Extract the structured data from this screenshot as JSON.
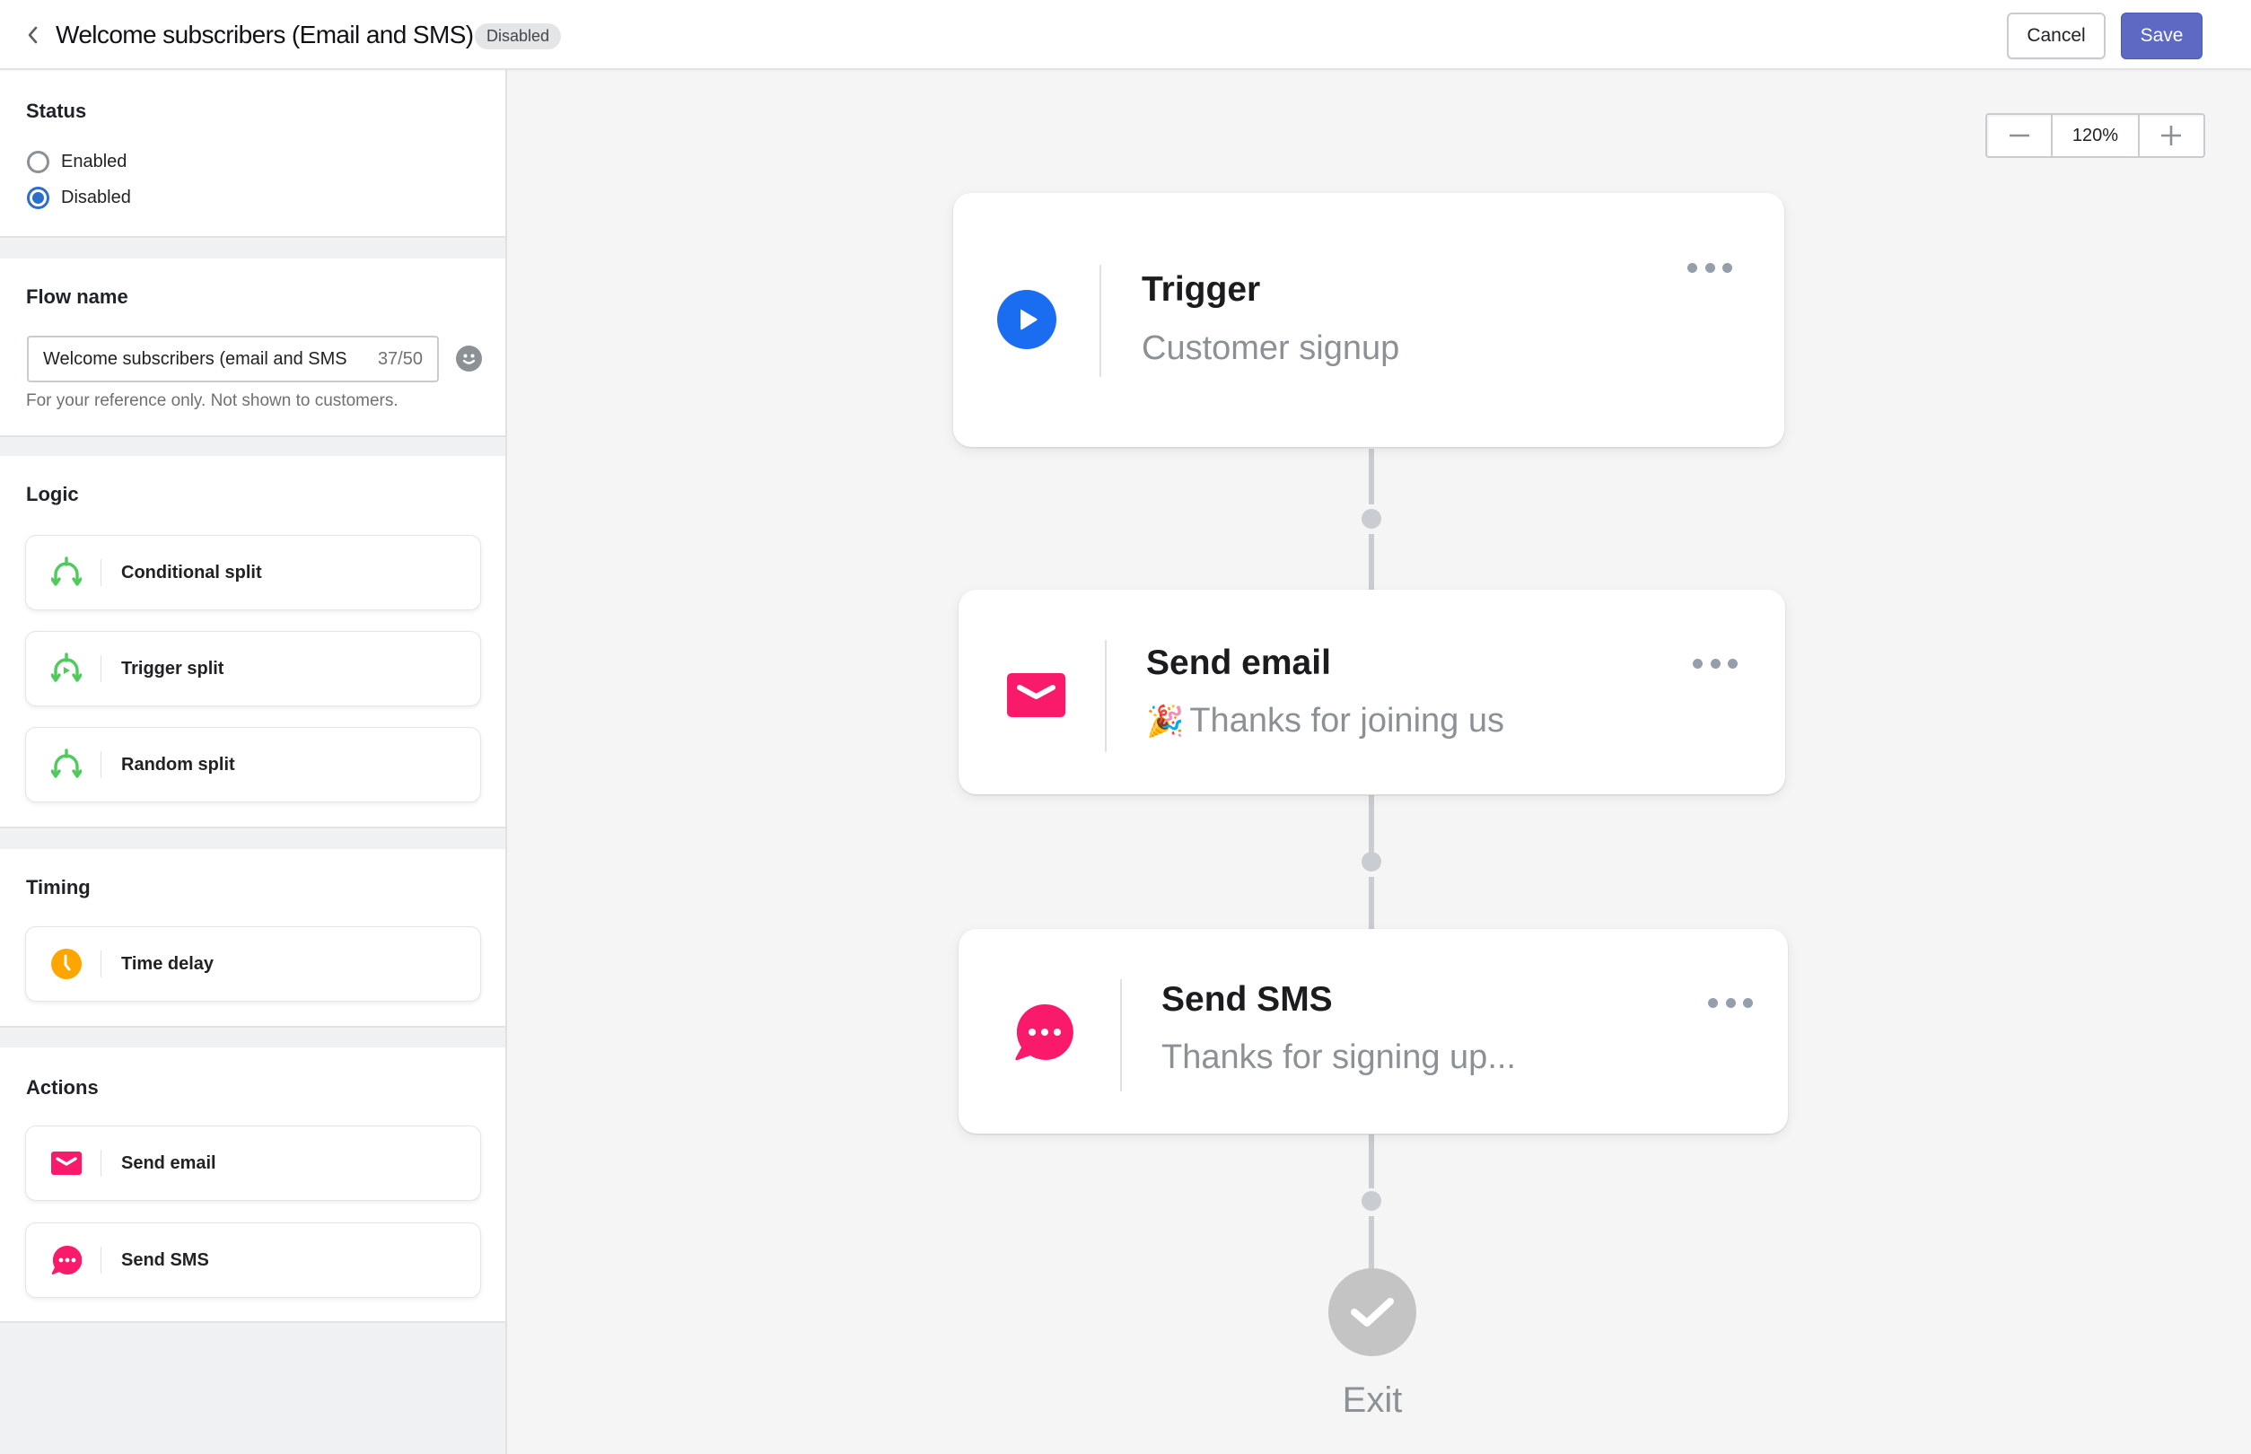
{
  "header": {
    "title": "Welcome subscribers (Email and SMS)",
    "status_badge": "Disabled",
    "cancel_label": "Cancel",
    "save_label": "Save",
    "back_icon": "chevron-left-icon"
  },
  "sidebar": {
    "status": {
      "heading": "Status",
      "options": [
        {
          "label": "Enabled",
          "checked": false
        },
        {
          "label": "Disabled",
          "checked": true
        }
      ]
    },
    "flow_name": {
      "heading": "Flow name",
      "value": "Welcome subscribers (email and SMS",
      "char_count": "37/50",
      "helper": "For your reference only. Not shown to customers.",
      "emoji_icon": "smiley-icon"
    },
    "logic": {
      "heading": "Logic",
      "items": [
        {
          "label": "Conditional split",
          "icon": "split-icon"
        },
        {
          "label": "Trigger split",
          "icon": "trigger-split-icon"
        },
        {
          "label": "Random split",
          "icon": "split-icon"
        }
      ]
    },
    "timing": {
      "heading": "Timing",
      "items": [
        {
          "label": "Time delay",
          "icon": "clock-icon"
        }
      ]
    },
    "actions": {
      "heading": "Actions",
      "items": [
        {
          "label": "Send email",
          "icon": "envelope-icon"
        },
        {
          "label": "Send SMS",
          "icon": "chat-bubble-icon"
        }
      ]
    }
  },
  "canvas": {
    "zoom": {
      "value": "120%",
      "zoom_out_icon": "minus-icon",
      "zoom_in_icon": "plus-icon"
    },
    "nodes": [
      {
        "type": "trigger",
        "title": "Trigger",
        "subtitle": "Customer signup",
        "icon": "play-icon"
      },
      {
        "type": "email",
        "title": "Send email",
        "subtitle_emoji": "🎉",
        "subtitle": "Thanks for joining us",
        "icon": "envelope-icon"
      },
      {
        "type": "sms",
        "title": "Send SMS",
        "subtitle": "Thanks for signing up...",
        "icon": "chat-bubble-icon"
      }
    ],
    "exit_label": "Exit"
  },
  "colors": {
    "primary": "#5c6ac4",
    "radio_selected": "#2c6ecb",
    "trigger_blue": "#1a6cf0",
    "action_pink": "#fa1a6c",
    "logic_green": "#4cd964",
    "timing_orange": "#ffa500",
    "connector_gray": "#c9ccd0"
  }
}
